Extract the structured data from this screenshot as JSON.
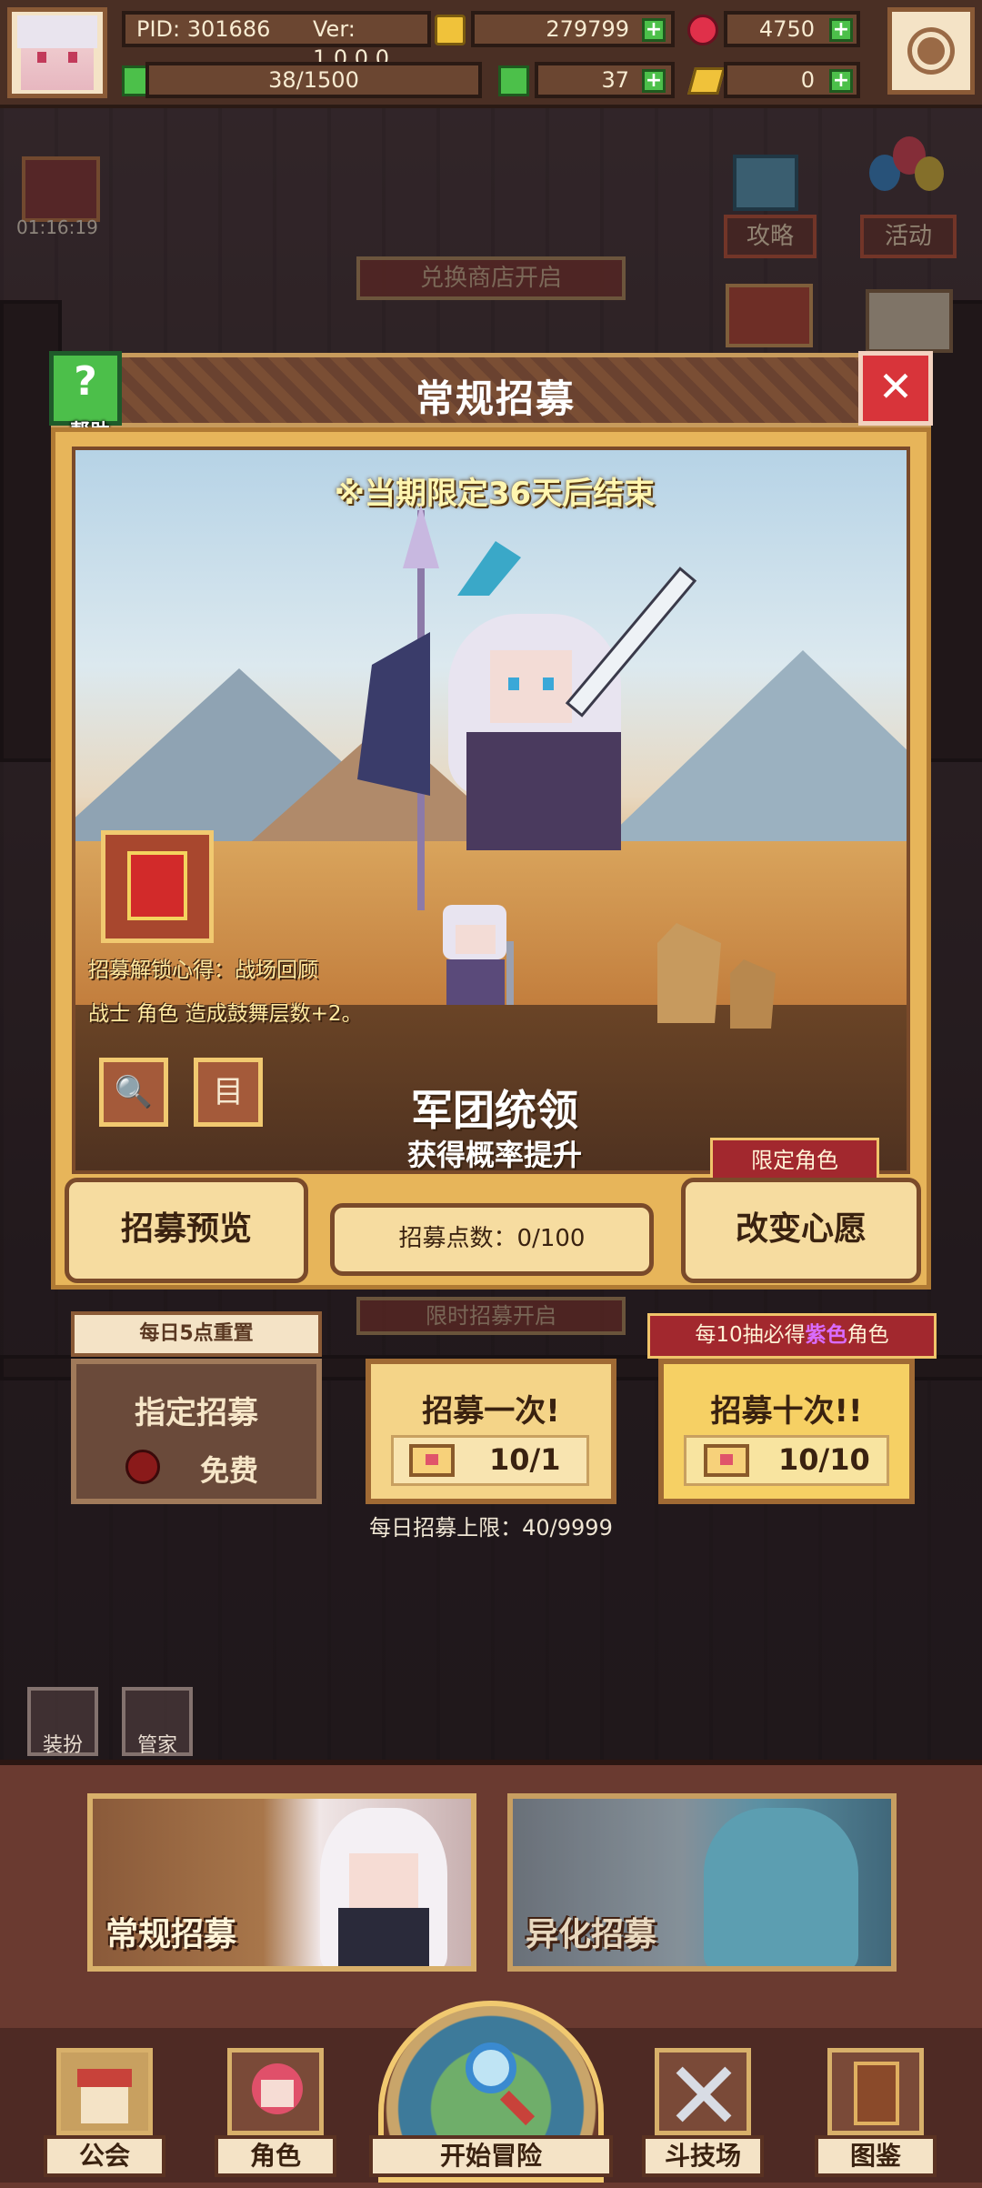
{
  "topbar": {
    "pid": "PID: 301686",
    "version": "Ver: 1.0.0.0",
    "gold": "279799",
    "gems": "4750",
    "stamina": "38/1500",
    "clover": "37",
    "cheese": "0"
  },
  "background": {
    "timer": "01:16:19",
    "guide_label": "攻略",
    "events_label": "活动",
    "exchange_banner": "兑换商店开启",
    "limited_banner": "限时招募开启",
    "dressup_label": "装扮",
    "butler_label": "管家"
  },
  "dialog": {
    "title": "常规招募",
    "help_label": "帮助",
    "close_glyph": "✕",
    "limited_note": "※当期限定36天后结束",
    "unlock_line1": "招募解锁心得：战场回顾",
    "unlock_line2": "战士 角色 造成鼓舞层数+2。",
    "character_name": "军团统领",
    "rate_up": "获得概率提升",
    "preview_label": "招募预览",
    "points_label": "招募点数：0/100",
    "limited_tag": "限定角色",
    "change_wish_label": "改变心愿",
    "magnify_glyph": "🔍",
    "list_glyph": "目"
  },
  "recruit": {
    "daily_reset": "每日5点重置",
    "designated_title": "指定招募",
    "designated_cost": "免费",
    "single_title": "招募一次!",
    "single_cost": "10/1",
    "guarantee_prefix": "每10抽必得",
    "guarantee_highlight": "紫色",
    "guarantee_suffix": "角色",
    "ten_title": "招募十次!!",
    "ten_cost": "10/10",
    "daily_limit": "每日招募上限：40/9999"
  },
  "recruit_tabs": {
    "regular": "常规招募",
    "mutation": "异化招募"
  },
  "nav": {
    "guild": "公会",
    "characters": "角色",
    "adventure": "开始冒险",
    "arena": "斗技场",
    "codex": "图鉴"
  },
  "colors": {
    "accent_gold": "#f1c970",
    "panel_brown": "#6a3a30",
    "close_red": "#d8343a",
    "help_green": "#4cbf4a",
    "purple_highlight": "#a23ad8"
  }
}
